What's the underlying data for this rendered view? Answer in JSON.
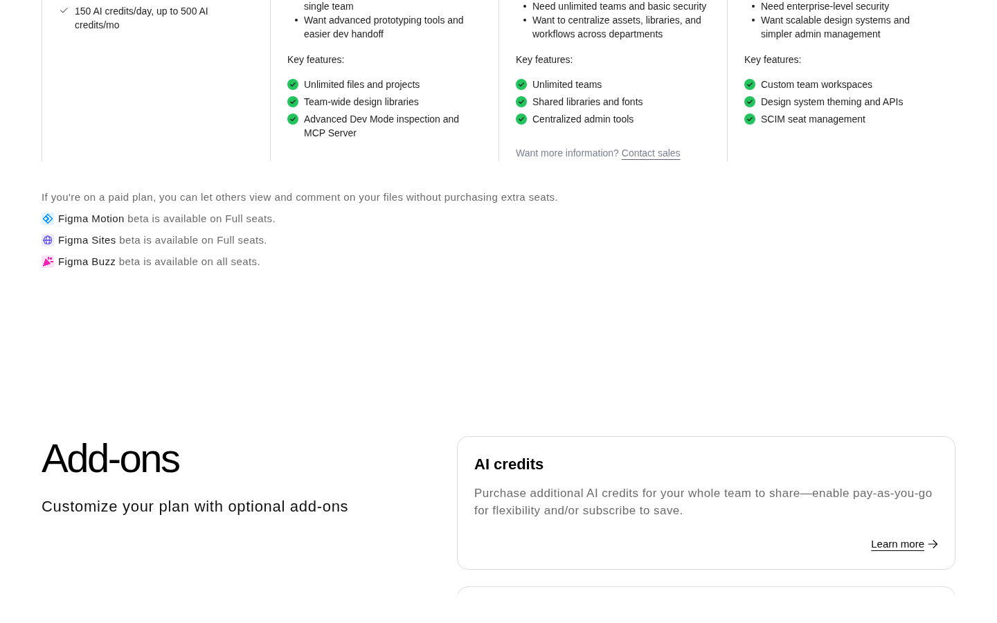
{
  "plans": [
    {
      "features": [
        {
          "kind": "plain",
          "text": "150 AI credits/day, up to 500 AI credits/mo"
        }
      ]
    },
    {
      "audience": [
        {
          "kind": "continuation",
          "text": "single team"
        },
        {
          "kind": "bullet",
          "text": "Want advanced prototyping tools and easier dev handoff"
        }
      ],
      "key_features_label": "Key features:",
      "features": [
        {
          "kind": "included",
          "text": "Unlimited files and projects"
        },
        {
          "kind": "included",
          "text": "Team-wide design libraries"
        },
        {
          "kind": "included",
          "text": "Advanced Dev Mode inspection and MCP Server"
        }
      ]
    },
    {
      "audience": [
        {
          "kind": "bullet",
          "text": "Need unlimited teams and basic security"
        },
        {
          "kind": "bullet",
          "text": "Want to centralize assets, libraries, and workflows across departments"
        }
      ],
      "key_features_label": "Key features:",
      "features": [
        {
          "kind": "included",
          "text": "Unlimited teams"
        },
        {
          "kind": "included",
          "text": "Shared libraries and fonts"
        },
        {
          "kind": "included",
          "text": "Centralized admin tools"
        }
      ],
      "footer": {
        "text": "Want more information?",
        "link": "Contact sales"
      }
    },
    {
      "audience": [
        {
          "kind": "bullet",
          "text": "Need enterprise-level security"
        },
        {
          "kind": "bullet",
          "text": "Want scalable design systems and simpler admin management"
        }
      ],
      "key_features_label": "Key features:",
      "features": [
        {
          "kind": "included",
          "text": "Custom team workspaces"
        },
        {
          "kind": "included",
          "text": "Design system theming and APIs"
        },
        {
          "kind": "included",
          "text": "SCIM seat management"
        }
      ]
    }
  ],
  "seat_note": "If you're on a paid plan, you can let others view and comment on your files without purchasing extra seats.",
  "betas": [
    {
      "kind": "diamond",
      "color": "#0d99ff",
      "product": "Figma Motion",
      "text": "beta is available on Full seats."
    },
    {
      "kind": "globe",
      "color": "#6e5cf6",
      "product": "Figma Sites",
      "text": "beta is available on Full seats."
    },
    {
      "kind": "confetti",
      "color": "#f522b5",
      "product": "Figma Buzz",
      "text": "beta is available on all seats."
    }
  ],
  "addons": {
    "title": "Add-ons",
    "subtitle": "Customize your plan with optional add-ons",
    "cards": [
      {
        "kind": "full",
        "title": "AI credits",
        "description": "Purchase additional AI credits for your whole team to share—enable pay-as-you-go for flexibility and/or subscribe to save.",
        "link": "Learn more"
      },
      {
        "kind": "clipped"
      }
    ]
  }
}
